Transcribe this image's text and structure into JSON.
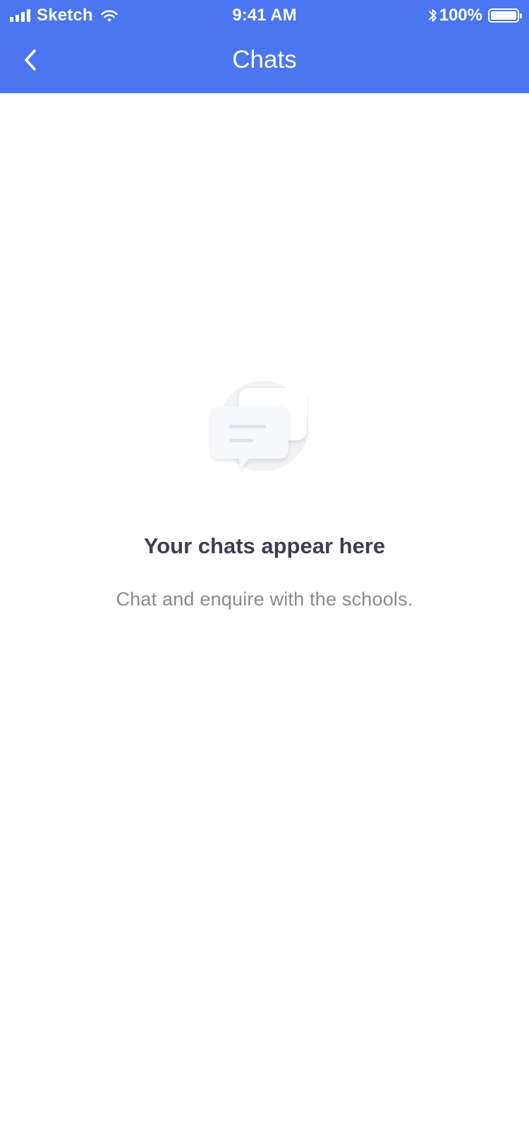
{
  "status_bar": {
    "carrier": "Sketch",
    "time": "9:41 AM",
    "battery_percent": "100%",
    "signal_bars": 4,
    "battery_level": 1.0
  },
  "nav": {
    "title": "Chats",
    "back_icon": "chevron-left-icon"
  },
  "empty_state": {
    "icon": "chat-bubbles-icon",
    "title": "Your chats appear here",
    "subtitle": "Chat and enquire with the schools."
  },
  "colors": {
    "header_bg": "#4a76f1",
    "title_text": "#3c3e54",
    "subtitle_text": "#8a8a8e",
    "background": "#ffffff"
  }
}
